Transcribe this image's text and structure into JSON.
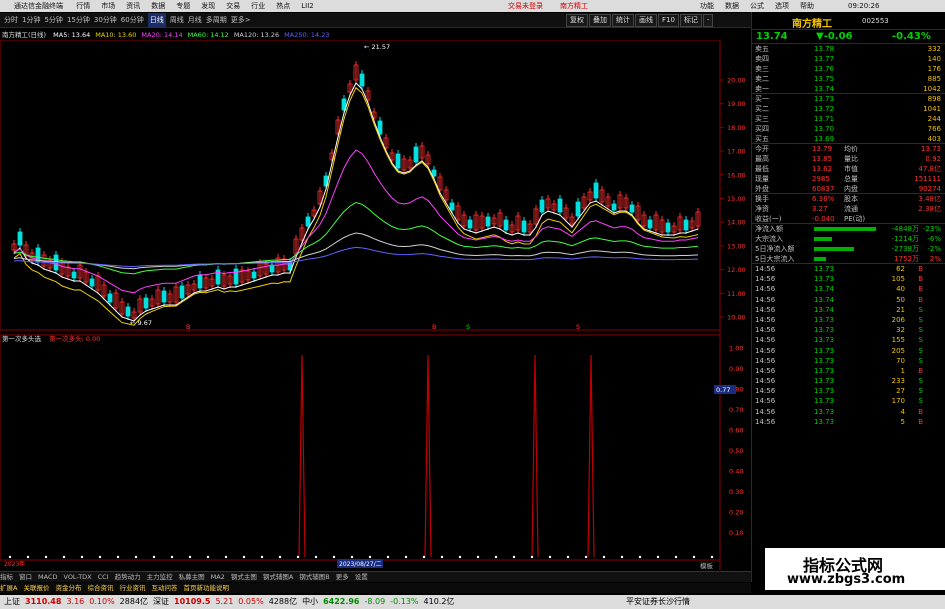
{
  "app": {
    "title": "通达信金融终端",
    "menus": [
      "行情",
      "市场",
      "资讯",
      "数据",
      "专题",
      "发现",
      "交易",
      "行业",
      "热点",
      "LII2"
    ],
    "trade_status": "交易未登录",
    "trade_stock": "南方精工",
    "right_menus": [
      "功能",
      "数据",
      "公式",
      "选项",
      "帮助"
    ],
    "time": "09:20:26"
  },
  "toolbar": {
    "periods": [
      "分时",
      "1分钟",
      "5分钟",
      "15分钟",
      "30分钟",
      "60分钟",
      "日线",
      "周线",
      "月线",
      "多周期",
      "更多>"
    ],
    "active_period": "日线",
    "right_buttons": [
      "复权",
      "叠加",
      "统计",
      "画线",
      "F10",
      "标记",
      "-"
    ]
  },
  "chart_header": {
    "name": "南方精工(日线)",
    "ma": [
      {
        "label": "MA5: 13.64",
        "color": "#ffffff"
      },
      {
        "label": "MA10: 13.60",
        "color": "#f0d000"
      },
      {
        "label": "MA20: 14.14",
        "color": "#ff40ff"
      },
      {
        "label": "MA60: 14.12",
        "color": "#40ff40"
      },
      {
        "label": "MA120: 13.26",
        "color": "#d0d0d0"
      },
      {
        "label": "MA250: 14.23",
        "color": "#6060ff"
      }
    ]
  },
  "chart": {
    "high_label": "21.57",
    "low_label": "9.67",
    "yticks": [
      "20.00",
      "19.00",
      "18.00",
      "17.00",
      "16.00",
      "15.00",
      "14.00",
      "13.00",
      "12.00",
      "11.00",
      "10.00"
    ],
    "signals": [
      {
        "text": "B",
        "color": "#ff3030"
      },
      {
        "text": "B",
        "color": "#ff3030"
      },
      {
        "text": "S",
        "color": "#00d000"
      },
      {
        "text": "S",
        "color": "#ff3030"
      }
    ],
    "signal_words": [
      {
        "text": "卖",
        "color": "#ff3030"
      },
      {
        "text": "卖",
        "color": "#ff3030"
      },
      {
        "text": "抛",
        "color": "#ff3030"
      },
      {
        "text": "卖",
        "color": "#ff3030"
      }
    ]
  },
  "indicator": {
    "name": "第一次多头选",
    "line_label": "第一次多头: 0.00",
    "yticks": [
      "1.00",
      "0.90",
      "0.80",
      "0.70",
      "0.60",
      "0.50",
      "0.40",
      "0.30",
      "0.20",
      "0.10"
    ],
    "value_tag": "0.77",
    "date_label": "2023/08/27/二",
    "year_label": "2023年"
  },
  "quote": {
    "name": "南方精工",
    "code": "002553",
    "price": "13.74",
    "change": "▼-0.06",
    "pct": "-0.43%",
    "asks": [
      [
        "卖五",
        "13.78",
        "332"
      ],
      [
        "卖四",
        "13.77",
        "140"
      ],
      [
        "卖三",
        "13.76",
        "176"
      ],
      [
        "卖二",
        "13.75",
        "885"
      ],
      [
        "卖一",
        "13.74",
        "1042"
      ]
    ],
    "bids": [
      [
        "买一",
        "13.73",
        "898"
      ],
      [
        "买二",
        "13.72",
        "1041"
      ],
      [
        "买三",
        "13.71",
        "244"
      ],
      [
        "买四",
        "13.70",
        "766"
      ],
      [
        "买五",
        "13.69",
        "403"
      ]
    ],
    "stats": [
      [
        "今开",
        "13.79",
        "均价",
        "13.73"
      ],
      [
        "最高",
        "13.85",
        "量比",
        "0.92"
      ],
      [
        "最低",
        "13.62",
        "市值",
        "47.8亿"
      ],
      [
        "现量",
        "2985",
        "总量",
        "151111"
      ],
      [
        "外盘",
        "60837",
        "内盘",
        "90274"
      ]
    ],
    "stats2": [
      [
        "换手",
        "6.36%",
        "股本",
        "3.48亿"
      ],
      [
        "净资",
        "3.27",
        "流通",
        "2.38亿"
      ],
      [
        "收益(一)",
        "-0.040",
        "PE(动)",
        ""
      ]
    ],
    "flows": [
      {
        "label": "净流入额",
        "value": "-4848万",
        "pct": "-23%",
        "w": 62
      },
      {
        "label": "大宗流入",
        "value": "-1214万",
        "pct": "-6%",
        "w": 18
      },
      {
        "label": "5日净流入额",
        "value": "-2738万",
        "pct": "-2%",
        "w": 40
      },
      {
        "label": "5日大宗流入",
        "value": "1752万",
        "pct": "2%",
        "w": 12
      }
    ],
    "ticks": [
      [
        "14:56",
        "13.73",
        "62",
        "B"
      ],
      [
        "14:56",
        "13.73",
        "105",
        "B"
      ],
      [
        "14:56",
        "13.74",
        "40",
        "B"
      ],
      [
        "14:56",
        "13.74",
        "50",
        "B"
      ],
      [
        "14:56",
        "13.74",
        "21",
        "S"
      ],
      [
        "14:56",
        "13.73",
        "206",
        "S"
      ],
      [
        "14:56",
        "13.73",
        "32",
        "S"
      ],
      [
        "14:56",
        "13.73",
        "155",
        "S"
      ],
      [
        "14:56",
        "13.73",
        "205",
        "S"
      ],
      [
        "14:56",
        "13.73",
        "70",
        "S"
      ],
      [
        "14:56",
        "13.73",
        "1",
        "B"
      ],
      [
        "14:56",
        "13.73",
        "233",
        "S"
      ],
      [
        "14:56",
        "13.73",
        "27",
        "S"
      ],
      [
        "14:56",
        "13.73",
        "170",
        "S"
      ],
      [
        "14:56",
        "13.73",
        "4",
        "B"
      ],
      [
        "14:56",
        "13.73",
        "5",
        "B"
      ]
    ]
  },
  "bottom_tabs": [
    "指标",
    "窗口",
    "MACD",
    "VOL-TDX",
    "CCI",
    "趋势动力",
    "主力监控",
    "私募主图",
    "MA2",
    "钢式主图",
    "钢式辅图A",
    "钢式辅图B",
    "更多",
    "设置"
  ],
  "bottom_tabs2": [
    "扩展A",
    "关联报价",
    "资金分布",
    "综合资讯",
    "行业资讯",
    "互动问答",
    "首页新功能说明"
  ],
  "bottom_right": [
    "图文F10",
    "区间统计",
    "模板"
  ],
  "status": [
    {
      "n": "上证",
      "v": "3110.48",
      "c": "3.16",
      "p": "0.10%",
      "a": "2884亿"
    },
    {
      "n": "深证",
      "v": "10109.5",
      "c": "5.21",
      "p": "0.05%",
      "a": "4288亿"
    },
    {
      "n": "中小",
      "v": "6422.96",
      "c": "-8.09",
      "p": "-0.13%",
      "a": "410.2亿"
    }
  ],
  "status_tail": "平安证券长沙行情",
  "watermark": {
    "line1": "指标公式网",
    "line2": "www.zbgs3.com"
  }
}
